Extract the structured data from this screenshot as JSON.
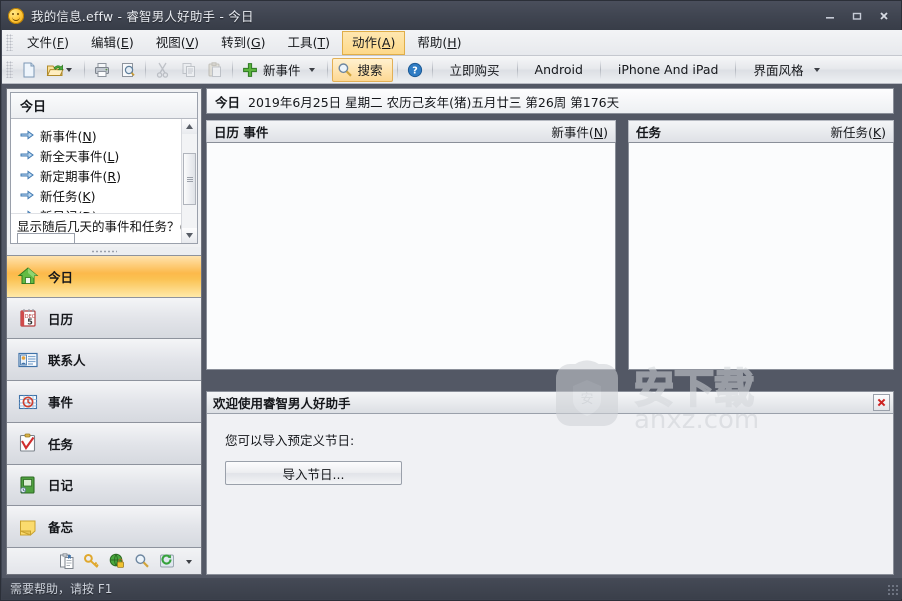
{
  "window": {
    "title": "我的信息.effw - 睿智男人好助手 - 今日",
    "icon": "smiley-icon",
    "controls": {
      "minimize": "–",
      "maximize": "□",
      "close": "✕"
    }
  },
  "menubar": {
    "items": [
      {
        "label": "文件",
        "accel": "F"
      },
      {
        "label": "编辑",
        "accel": "E"
      },
      {
        "label": "视图",
        "accel": "V"
      },
      {
        "label": "转到",
        "accel": "G"
      },
      {
        "label": "工具",
        "accel": "T"
      },
      {
        "label": "动作",
        "accel": "A",
        "active": true
      },
      {
        "label": "帮助",
        "accel": "H"
      }
    ]
  },
  "toolbar": {
    "new_icon": "new-document-icon",
    "open_icon": "open-folder-icon",
    "print_icon": "print-icon",
    "print_preview_icon": "print-preview-icon",
    "cut_icon": "cut-icon",
    "copy_icon": "copy-icon",
    "paste_icon": "paste-icon",
    "new_event_icon": "green-plus-icon",
    "new_event_label": "新事件",
    "search_icon": "magnifier-icon",
    "search_label": "搜索",
    "help_icon": "help-circle-icon",
    "buy_label": "立即购买",
    "android_label": "Android",
    "iphone_label": "iPhone And iPad",
    "skin_label": "界面风格"
  },
  "sidebar": {
    "today_panel": {
      "header": "今日",
      "links": [
        {
          "label": "新事件",
          "accel": "N",
          "icon": "arrow-right-icon"
        },
        {
          "label": "新全天事件",
          "accel": "L",
          "icon": "arrow-right-icon"
        },
        {
          "label": "新定期事件",
          "accel": "R",
          "icon": "arrow-right-icon"
        },
        {
          "label": "新任务",
          "accel": "K",
          "icon": "arrow-right-icon"
        },
        {
          "label": "新日记",
          "accel": "D",
          "icon": "arrow-right-icon"
        }
      ],
      "question": "显示随后几天的事件和任务？",
      "question_accel": "S",
      "question_value": ""
    },
    "nav_items": [
      {
        "label": "今日",
        "icon": "home-icon",
        "selected": true
      },
      {
        "label": "日历",
        "icon": "calendar-icon",
        "selected": false
      },
      {
        "label": "联系人",
        "icon": "contacts-icon",
        "selected": false
      },
      {
        "label": "事件",
        "icon": "event-icon",
        "selected": false
      },
      {
        "label": "任务",
        "icon": "task-checklist-icon",
        "selected": false
      },
      {
        "label": "日记",
        "icon": "journal-icon",
        "selected": false
      },
      {
        "label": "备忘",
        "icon": "sticky-note-icon",
        "selected": false
      }
    ],
    "footer_icons": [
      "clipboard-icon",
      "key-icon",
      "globe-lock-icon",
      "magnifier-icon",
      "refresh-icon",
      "chevron-down-icon"
    ]
  },
  "main": {
    "date_bar": {
      "today_label": "今日",
      "date_text": "2019年6月25日 星期二 农历己亥年(猪)五月廿三  第26周 第176天"
    },
    "panels": [
      {
        "title": "日历 事件",
        "action_label": "新事件",
        "action_accel": "N",
        "items": []
      },
      {
        "title": "任务",
        "action_label": "新任务",
        "action_accel": "K",
        "items": []
      }
    ],
    "welcome": {
      "title": "欢迎使用睿智男人好助手",
      "close_icon": "close-icon",
      "text": "您可以导入预定义节日:",
      "button_label": "导入节日..."
    },
    "watermark": {
      "text": "安下载",
      "url": "anxz.com"
    }
  },
  "statusbar": {
    "text": "需要帮助，请按 F1"
  },
  "colors": {
    "titlebar": "#3f4450",
    "accent_selected": "#fcb94b",
    "menu_active": "#fdd98a",
    "panel_bg": "#fbfcfd",
    "status_text": "#cfd4de"
  }
}
